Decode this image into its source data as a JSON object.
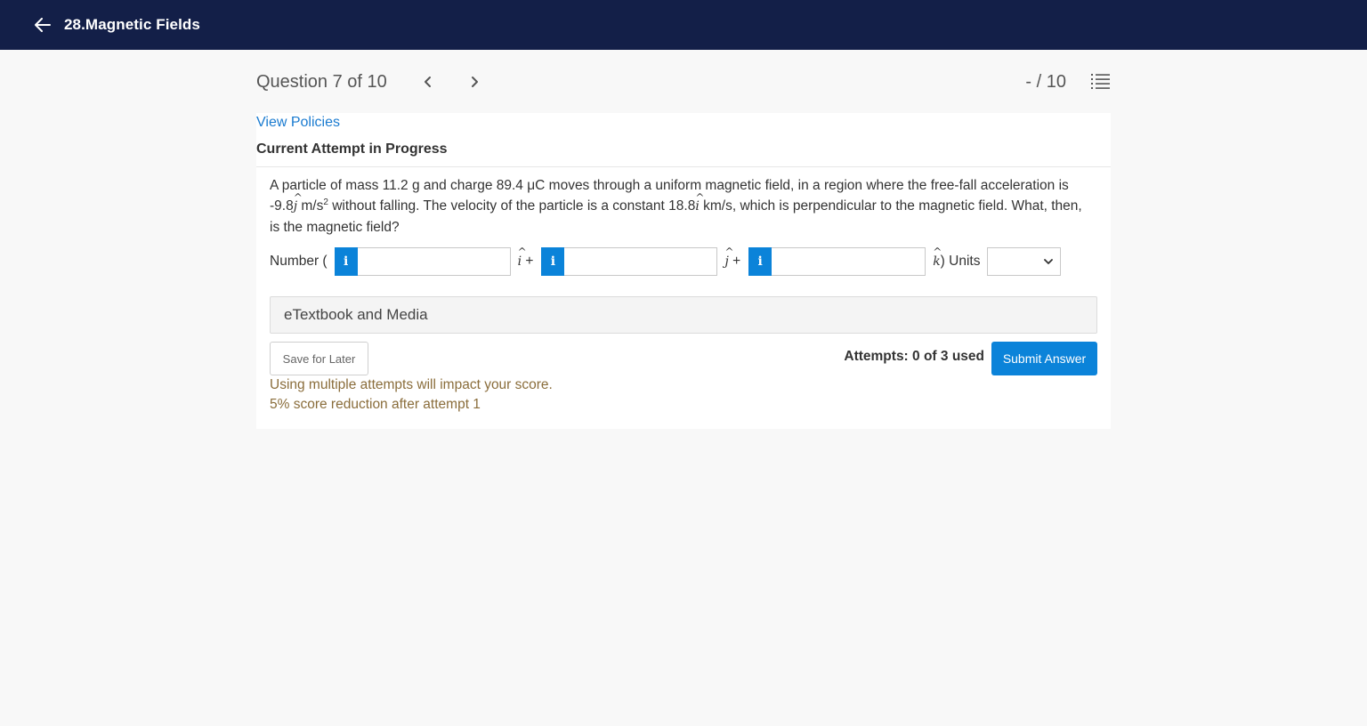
{
  "topbar": {
    "title": "28.Magnetic Fields"
  },
  "question_header": {
    "counter": "Question 7 of 10",
    "score": "- / 10"
  },
  "panel": {
    "view_policies": "View Policies",
    "attempt_status": "Current Attempt in Progress"
  },
  "question": {
    "text_1": "A particle of mass 11.2 g and charge 89.4 μC moves through a uniform magnetic field, in a region where the free-fall acceleration is -9.8",
    "j_unit": "j",
    "text_2": " m/s",
    "exp": "2",
    "text_3": " without falling. The velocity of the particle is a constant 18.8",
    "i_unit": "i",
    "text_4": " km/s, which is perpendicular to the magnetic field. What, then, is the magnetic field?"
  },
  "answer": {
    "number_label": "Number (",
    "info_label": "i",
    "i_symbol": "i",
    "plus": "+",
    "j_symbol": "j",
    "k_symbol": "k",
    "close_units": ") Units",
    "value_i": "",
    "value_j": "",
    "value_k": "",
    "units_selected": ""
  },
  "etextbook": {
    "label": "eTextbook and Media"
  },
  "actions": {
    "save_later": "Save for Later",
    "attempts": "Attempts: 0 of 3 used",
    "submit": "Submit Answer"
  },
  "warnings": {
    "line1": "Using multiple attempts will impact your score.",
    "line2": "5% score reduction after attempt 1"
  },
  "colors": {
    "topbar": "#131f48",
    "accent": "#0b83d9",
    "link": "#1a7bd0",
    "warning": "#8a6d3b"
  }
}
